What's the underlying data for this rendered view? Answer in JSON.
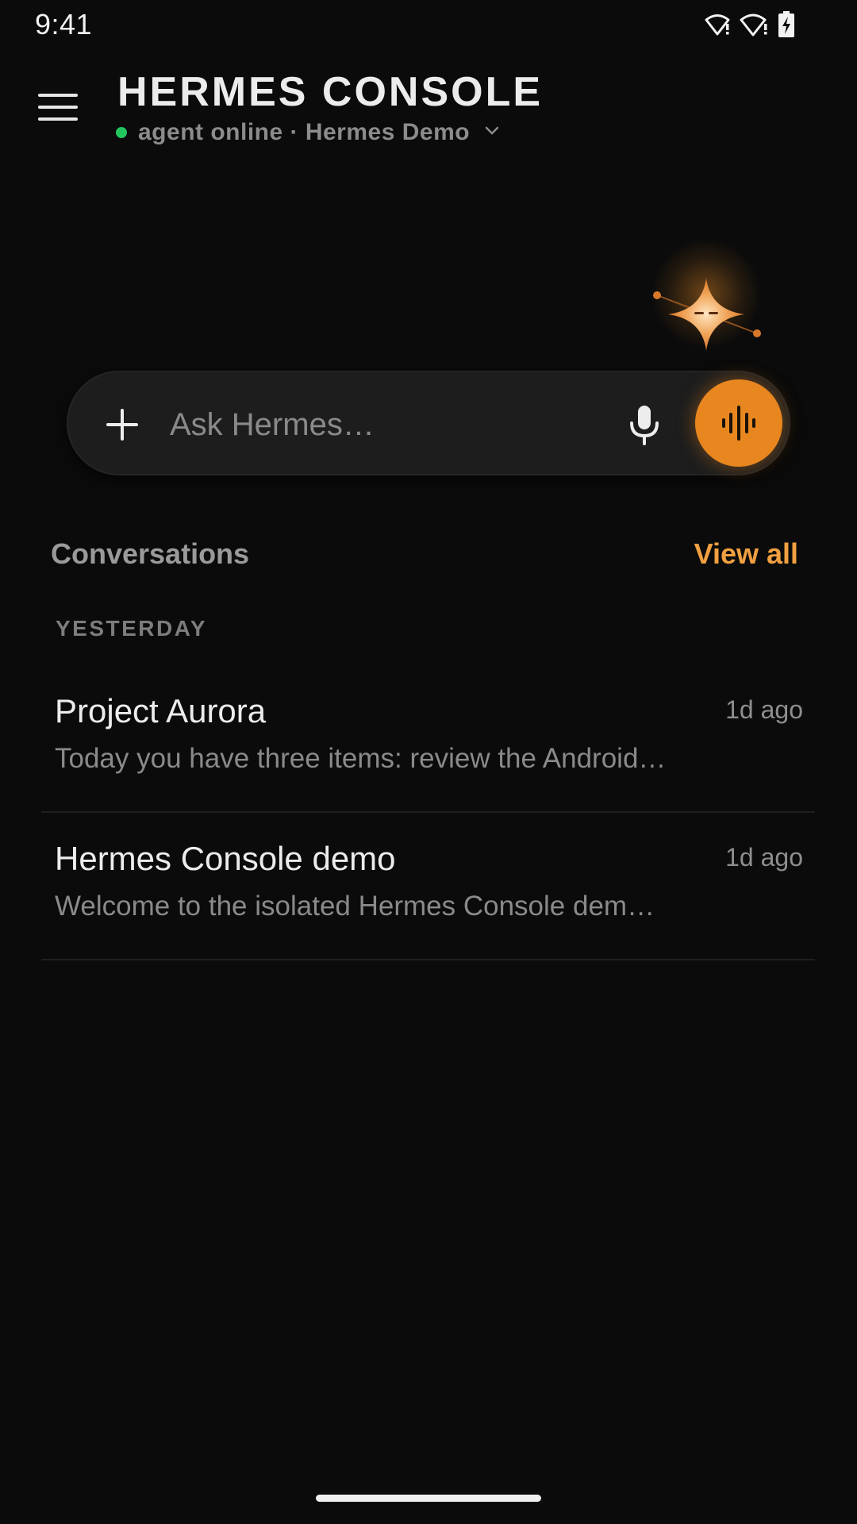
{
  "status_bar": {
    "time": "9:41",
    "icons": [
      "wifi-alert-icon",
      "wifi-alert-icon",
      "battery-charging-icon"
    ]
  },
  "header": {
    "menu_icon": "hamburger-menu-icon",
    "title": "HERMES CONSOLE",
    "subtitle": "agent online · Hermes Demo",
    "status_color": "#22c55e"
  },
  "ask_bar": {
    "placeholder": "Ask Hermes…",
    "value": "",
    "plus_icon": "plus-icon",
    "mic_icon": "microphone-icon",
    "voice_icon": "voice-waveform-icon"
  },
  "conversations": {
    "title": "Conversations",
    "view_all": "View all",
    "group_label": "YESTERDAY",
    "items": [
      {
        "title": "Project Aurora",
        "time": "1d ago",
        "preview": "Today you have three items: review the Android…"
      },
      {
        "title": "Hermes Console demo",
        "time": "1d ago",
        "preview": "Welcome to the isolated Hermes Console dem…"
      }
    ]
  },
  "colors": {
    "background": "#0b0b0b",
    "accent": "#e8861f",
    "link": "#f0a040",
    "online": "#22c55e"
  }
}
